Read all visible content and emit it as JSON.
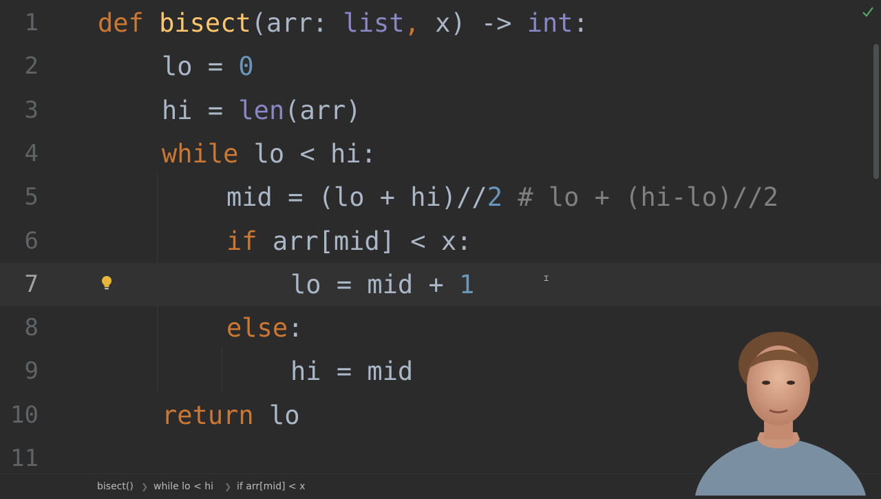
{
  "editor": {
    "current_line": 7,
    "lines": [
      {
        "number": "1",
        "tokens": [
          [
            "kw",
            "def "
          ],
          [
            "fn",
            "bisect"
          ],
          [
            "op",
            "(arr: "
          ],
          [
            "bi",
            "list"
          ],
          [
            "kw",
            ", "
          ],
          [
            "op",
            "x) -> "
          ],
          [
            "bi",
            "int"
          ],
          [
            "op",
            ":"
          ]
        ]
      },
      {
        "number": "2",
        "tokens": [
          [
            "op",
            "lo = "
          ],
          [
            "num",
            "0"
          ]
        ]
      },
      {
        "number": "3",
        "tokens": [
          [
            "op",
            "hi = "
          ],
          [
            "bi",
            "len"
          ],
          [
            "op",
            "(arr)"
          ]
        ]
      },
      {
        "number": "4",
        "tokens": [
          [
            "kw",
            "while "
          ],
          [
            "op",
            "lo < hi:"
          ]
        ]
      },
      {
        "number": "5",
        "tokens": [
          [
            "op",
            "mid = (lo + hi)//"
          ],
          [
            "num",
            "2"
          ],
          [
            "op",
            " "
          ],
          [
            "cm",
            "# lo + (hi-lo)//2"
          ]
        ]
      },
      {
        "number": "6",
        "tokens": [
          [
            "kw",
            "if "
          ],
          [
            "op",
            "arr[mid] < x:"
          ]
        ]
      },
      {
        "number": "7",
        "tokens": [
          [
            "op",
            "lo = mid + "
          ],
          [
            "num",
            "1"
          ]
        ]
      },
      {
        "number": "8",
        "tokens": [
          [
            "kw",
            "else"
          ],
          [
            "op",
            ":"
          ]
        ]
      },
      {
        "number": "9",
        "tokens": [
          [
            "op",
            "hi = mid"
          ]
        ]
      },
      {
        "number": "10",
        "tokens": [
          [
            "kw",
            "return "
          ],
          [
            "op",
            "lo"
          ]
        ]
      },
      {
        "number": "11",
        "tokens": []
      }
    ]
  },
  "gutter": {
    "intention_icon": "lightbulb-icon",
    "inspection_status_icon": "checkmark-icon"
  },
  "breadcrumb": {
    "items": [
      "bisect()",
      "while lo < hi",
      "if arr[mid] < x"
    ]
  },
  "colors": {
    "background": "#2b2b2b",
    "current_line": "#323232",
    "keyword": "#cc7832",
    "function": "#ffc66d",
    "builtin": "#8888c6",
    "number": "#6897bb",
    "text": "#a9b7c6",
    "comment": "#808080",
    "line_number": "#606366"
  },
  "webcam": {
    "icon": "presenter-webcam"
  }
}
